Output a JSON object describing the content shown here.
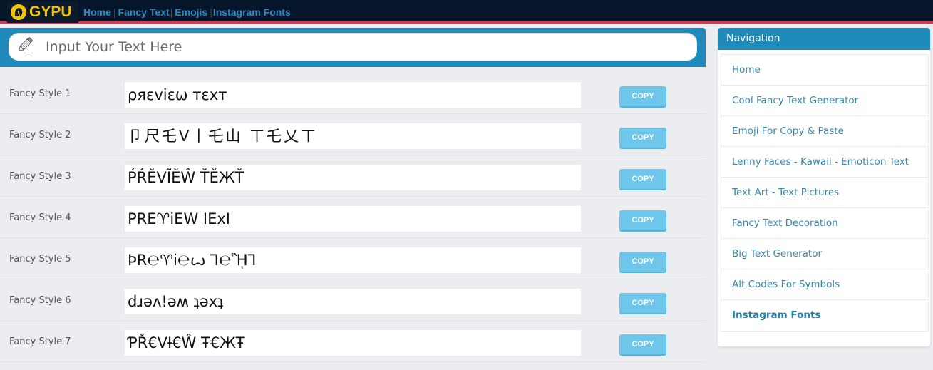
{
  "header": {
    "logo_text": "GYPU",
    "logo_icon": "gypu-logo-icon",
    "nav": [
      {
        "label": "Home"
      },
      {
        "label": "Fancy Text"
      },
      {
        "label": "Emojis"
      },
      {
        "label": "Instagram Fonts"
      }
    ],
    "separator": "|"
  },
  "input": {
    "placeholder": "Input Your Text Here",
    "value": "",
    "icon": "pencil-icon"
  },
  "styles": [
    {
      "label": "Fancy Style 1",
      "preview": "ρяεviεω тεxт",
      "button": "COPY"
    },
    {
      "label": "Fancy Style 2",
      "preview": "卩尺乇V丨乇山 ㄒ乇乂ㄒ",
      "button": "COPY"
    },
    {
      "label": "Fancy Style 3",
      "preview": "ṔŔĚVĨĚŴ ŤĚЖŤ",
      "button": "COPY"
    },
    {
      "label": "Fancy Style 4",
      "preview": "PRE♈iEW IExI",
      "button": "COPY"
    },
    {
      "label": "Fancy Style 5",
      "preview": "ϷR℮♈i℮ꙍ Ꞁ℮ᾛꞀ",
      "button": "COPY"
    },
    {
      "label": "Fancy Style 6",
      "preview": "dɹǝʌ!ǝʍ ʇǝxʇ",
      "button": "COPY"
    },
    {
      "label": "Fancy Style 7",
      "preview": "ƤŘ€VƗ€Ŵ Ŧ€ЖŦ",
      "button": "COPY"
    }
  ],
  "sidebar": {
    "title": "Navigation",
    "items": [
      {
        "label": "Home",
        "active": false
      },
      {
        "label": "Cool Fancy Text Generator",
        "active": false
      },
      {
        "label": "Emoji For Copy & Paste",
        "active": false
      },
      {
        "label": "Lenny Faces - Kawaii - Emoticon Text",
        "active": false
      },
      {
        "label": "Text Art - Text Pictures",
        "active": false
      },
      {
        "label": "Fancy Text Decoration",
        "active": false
      },
      {
        "label": "Big Text Generator",
        "active": false
      },
      {
        "label": "Alt Codes For Symbols",
        "active": false
      },
      {
        "label": "Instagram Fonts",
        "active": true
      }
    ]
  },
  "colors": {
    "topbar": "#06162a",
    "accent_red": "#d53a4e",
    "brand_yellow": "#f4c400",
    "primary_blue": "#1e8bbc",
    "link_blue": "#2c8ac4",
    "copy_button": "#6ec6eb"
  }
}
